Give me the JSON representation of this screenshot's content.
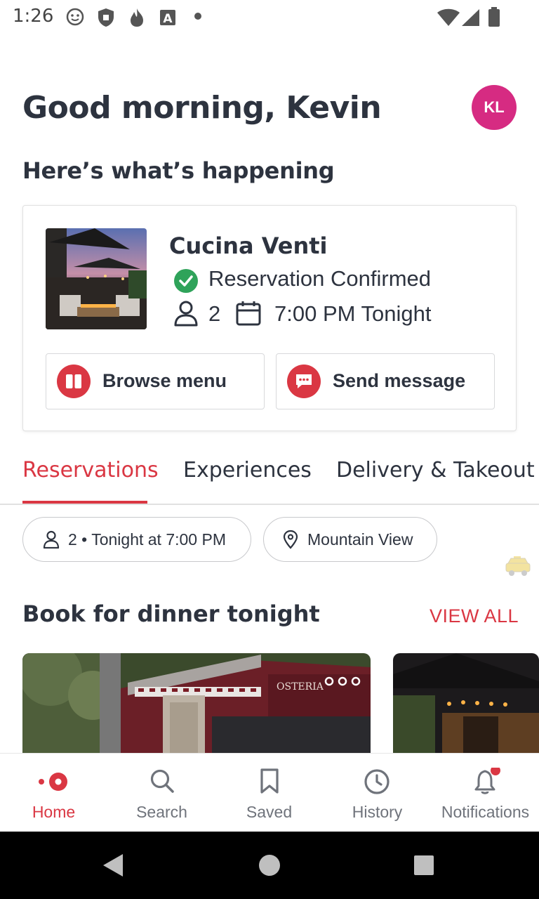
{
  "status_bar": {
    "time": "1:26"
  },
  "header": {
    "greeting": "Good morning, Kevin",
    "avatar_initials": "KL",
    "avatar_color": "#d62b82"
  },
  "happening": {
    "title": "Here’s what’s happening"
  },
  "reservation": {
    "restaurant": "Cucina Venti",
    "status": "Reservation Confirmed",
    "party_size": "2",
    "time": "7:00 PM Tonight",
    "browse_menu_label": "Browse menu",
    "send_message_label": "Send message"
  },
  "tabs": [
    {
      "label": "Reservations",
      "active": true
    },
    {
      "label": "Experiences",
      "active": false
    },
    {
      "label": "Delivery & Takeout",
      "active": false
    }
  ],
  "filters": {
    "party_time": "2 • Tonight at 7:00 PM",
    "location": "Mountain View"
  },
  "section": {
    "title": "Book for dinner tonight",
    "view_all": "VIEW ALL"
  },
  "bottom_nav": [
    {
      "label": "Home",
      "icon": "home-icon",
      "active": true
    },
    {
      "label": "Search",
      "icon": "search-icon",
      "active": false
    },
    {
      "label": "Saved",
      "icon": "bookmark-icon",
      "active": false
    },
    {
      "label": "History",
      "icon": "clock-icon",
      "active": false
    },
    {
      "label": "Notifications",
      "icon": "bell-icon",
      "active": false,
      "badge": true
    }
  ],
  "colors": {
    "accent": "#da3743",
    "confirmed": "#2fa35a",
    "text": "#2d333f"
  }
}
